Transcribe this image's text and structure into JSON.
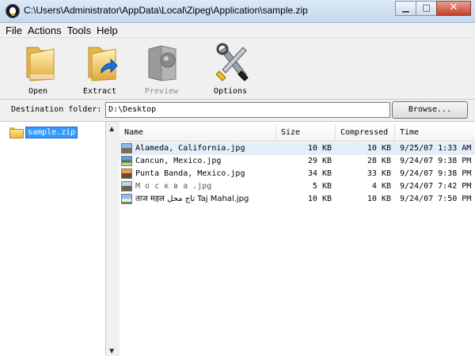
{
  "window": {
    "title": "C:\\Users\\Administrator\\AppData\\Local\\Zipeg\\Application\\sample.zip",
    "minimize_glyph": "▁",
    "maximize_glyph": "□",
    "close_glyph": "✕"
  },
  "menu": {
    "items": [
      {
        "label": "File"
      },
      {
        "label": "Actions"
      },
      {
        "label": "Tools"
      },
      {
        "label": "Help"
      }
    ]
  },
  "toolbar": {
    "buttons": [
      {
        "label": "Open",
        "icon": "folder-icon",
        "enabled": true
      },
      {
        "label": "Extract",
        "icon": "extract-icon",
        "enabled": true
      },
      {
        "label": "Preview",
        "icon": "preview-icon",
        "enabled": false
      },
      {
        "label": "Options",
        "icon": "tools-icon",
        "enabled": true
      }
    ]
  },
  "destination": {
    "label": "Destination folder:",
    "value": "D:\\Desktop",
    "browse_label": "Browse..."
  },
  "tree": {
    "root": {
      "label": "sample.zip",
      "icon": "folder-icon",
      "selected": true
    }
  },
  "list": {
    "columns": [
      {
        "label": "Name"
      },
      {
        "label": "Size"
      },
      {
        "label": "Compressed"
      },
      {
        "label": "Time"
      }
    ],
    "rows": [
      {
        "name": "Alameda, California.jpg",
        "size": "10 KB",
        "compressed": "10 KB",
        "time": "9/25/07 1:33 AM",
        "selected": true
      },
      {
        "name": "Cancun, Mexico.jpg",
        "size": "29 KB",
        "compressed": "28 KB",
        "time": "9/24/07 9:38 PM",
        "selected": false
      },
      {
        "name": "Punta Banda, Mexico.jpg",
        "size": "34 KB",
        "compressed": "33 KB",
        "time": "9/24/07 9:38 PM",
        "selected": false
      },
      {
        "name": "М о с к в а .jpg",
        "size": "5 KB",
        "compressed": "4 KB",
        "time": "9/24/07 7:42 PM",
        "selected": false
      },
      {
        "name": "ताज महल تاج محل Taj Mahal.jpg",
        "size": "10 KB",
        "compressed": "10 KB",
        "time": "9/24/07 7:50 PM",
        "selected": false
      }
    ]
  },
  "colors": {
    "selection": "#3399ff",
    "row_selected": "#e3eefb"
  }
}
